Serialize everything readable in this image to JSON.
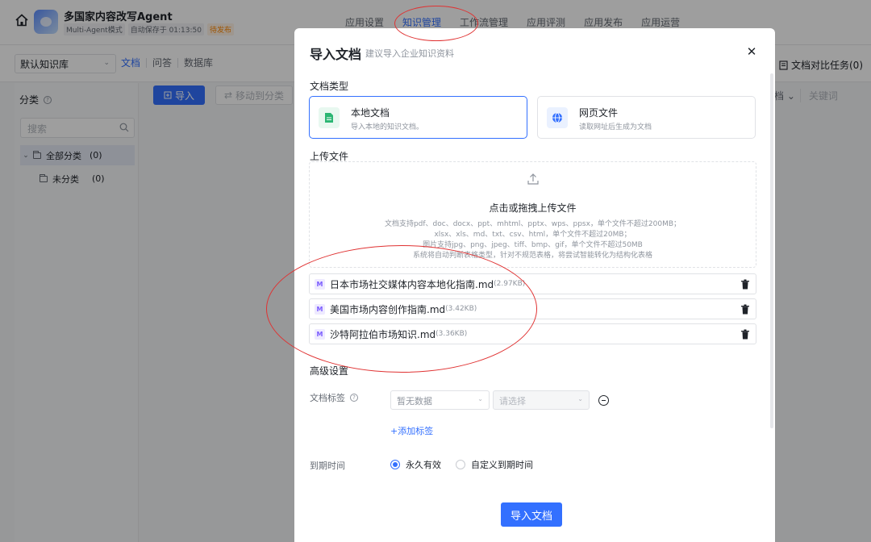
{
  "header": {
    "app_title": "多国家内容改写Agent",
    "mode": "Multi-Agent模式",
    "autosave": "自动保存于 01:13:50",
    "status": "待发布",
    "tabs": [
      {
        "label": "应用设置"
      },
      {
        "label": "知识管理",
        "active": true
      },
      {
        "label": "工作流管理"
      },
      {
        "label": "应用评测"
      },
      {
        "label": "应用发布"
      },
      {
        "label": "应用运营"
      }
    ]
  },
  "subbar": {
    "kb_select": "默认知识库",
    "tabs": [
      "文档",
      "问答",
      "数据库"
    ],
    "compare_task": "文档对比任务(0)"
  },
  "left_panel": {
    "category_label": "分类",
    "search_placeholder": "搜索",
    "tree": [
      {
        "label": "全部分类",
        "count": "(0)"
      },
      {
        "label": "未分类",
        "count": "(0)"
      }
    ]
  },
  "main": {
    "import_button": "导入",
    "move_button": "移动到分类",
    "filter_partial": "档",
    "keyword_placeholder": "关键词"
  },
  "modal": {
    "title": "导入文档",
    "subtitle": "建议导入企业知识资料",
    "doc_type_label": "文档类型",
    "types": [
      {
        "name": "本地文档",
        "desc": "导入本地的知识文档。",
        "selected": true
      },
      {
        "name": "网页文件",
        "desc": "读取网址后生成为文档",
        "selected": false
      }
    ],
    "upload_label": "上传文件",
    "upload_main": "点击或拖拽上传文件",
    "upload_hints": [
      "文档支持pdf、doc、docx、ppt、mhtml、pptx、wps、ppsx，单个文件不超过200MB；",
      "xlsx、xls、md、txt、csv、html，单个文件不超过20MB；",
      "图片支持jpg、png、jpeg、tiff、bmp、gif，单个文件不超过50MB",
      "系统将自动判断表格类型，针对不规范表格，将尝试智能转化为结构化表格"
    ],
    "files": [
      {
        "name": "日本市场社交媒体内容本地化指南.md",
        "size": "(2.97KB)"
      },
      {
        "name": "美国市场内容创作指南.md",
        "size": "(3.42KB)"
      },
      {
        "name": "沙特阿拉伯市场知识.md",
        "size": "(3.36KB)"
      }
    ],
    "advanced_label": "高级设置",
    "tag_label": "文档标签",
    "tag_select": "暂无数据",
    "tag_value_select": "请选择",
    "add_tag": "+添加标签",
    "expiry_label": "到期时间",
    "expiry_options": [
      {
        "label": "永久有效",
        "checked": true
      },
      {
        "label": "自定义到期时间",
        "checked": false
      }
    ],
    "submit": "导入文档"
  },
  "colors": {
    "primary": "#3370ff",
    "annotation": "#e03232",
    "status_orange": "#ff8800"
  }
}
